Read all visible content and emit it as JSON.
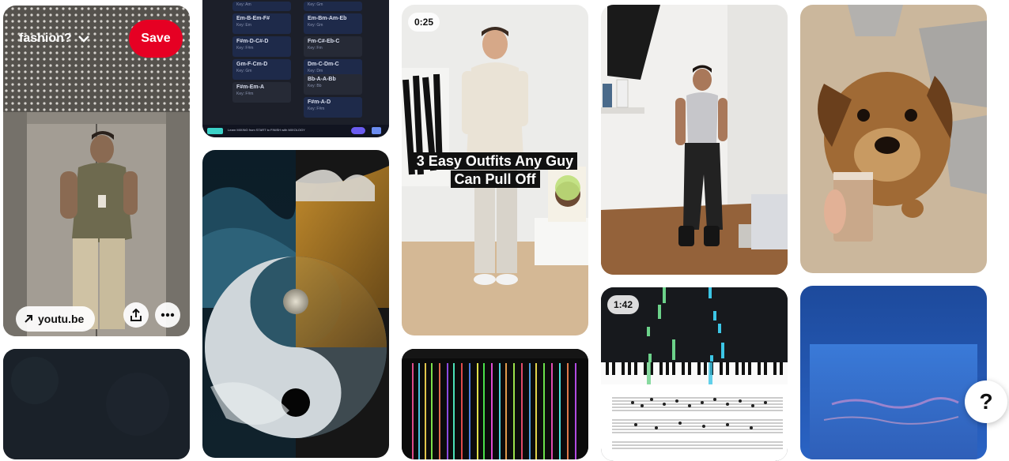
{
  "pins": {
    "elevator": {
      "board_label": "fashion?",
      "save_label": "Save",
      "link_domain": "youtu.be"
    },
    "chords": {
      "left": [
        {
          "name": "Em-B-Em-F#",
          "key": "Key: Em"
        },
        {
          "name": "F#m-D-C#-D",
          "key": "Key: F#m"
        },
        {
          "name": "Gm-F-Cm-D",
          "key": "Key: Gm"
        },
        {
          "name": "F#m-Em-A",
          "key": "Key: F#m"
        }
      ],
      "left_top_key": "Key: Am",
      "right": [
        {
          "name": "Em-Bm-Am-Eb",
          "key": "Key: Gm"
        },
        {
          "name": "Fm-C#-Eb-C",
          "key": "Key: Fm"
        },
        {
          "name": "Dm-C-Dm-C",
          "key": "Key: Dm"
        },
        {
          "name": "Bb-A-A-Bb",
          "key": "Key: Bb"
        },
        {
          "name": "F#m-A-D",
          "key": "Key: F#m"
        }
      ],
      "right_top_key": "Key: Gm",
      "footer": "Learn MIXING from START to FINISH with MIXOLOGY"
    },
    "outfits": {
      "duration": "0:25",
      "caption_line1": "3 Easy Outfits Any Guy",
      "caption_line2": "Can Pull Off"
    },
    "piano": {
      "duration": "1:42"
    }
  },
  "help_label": "?"
}
